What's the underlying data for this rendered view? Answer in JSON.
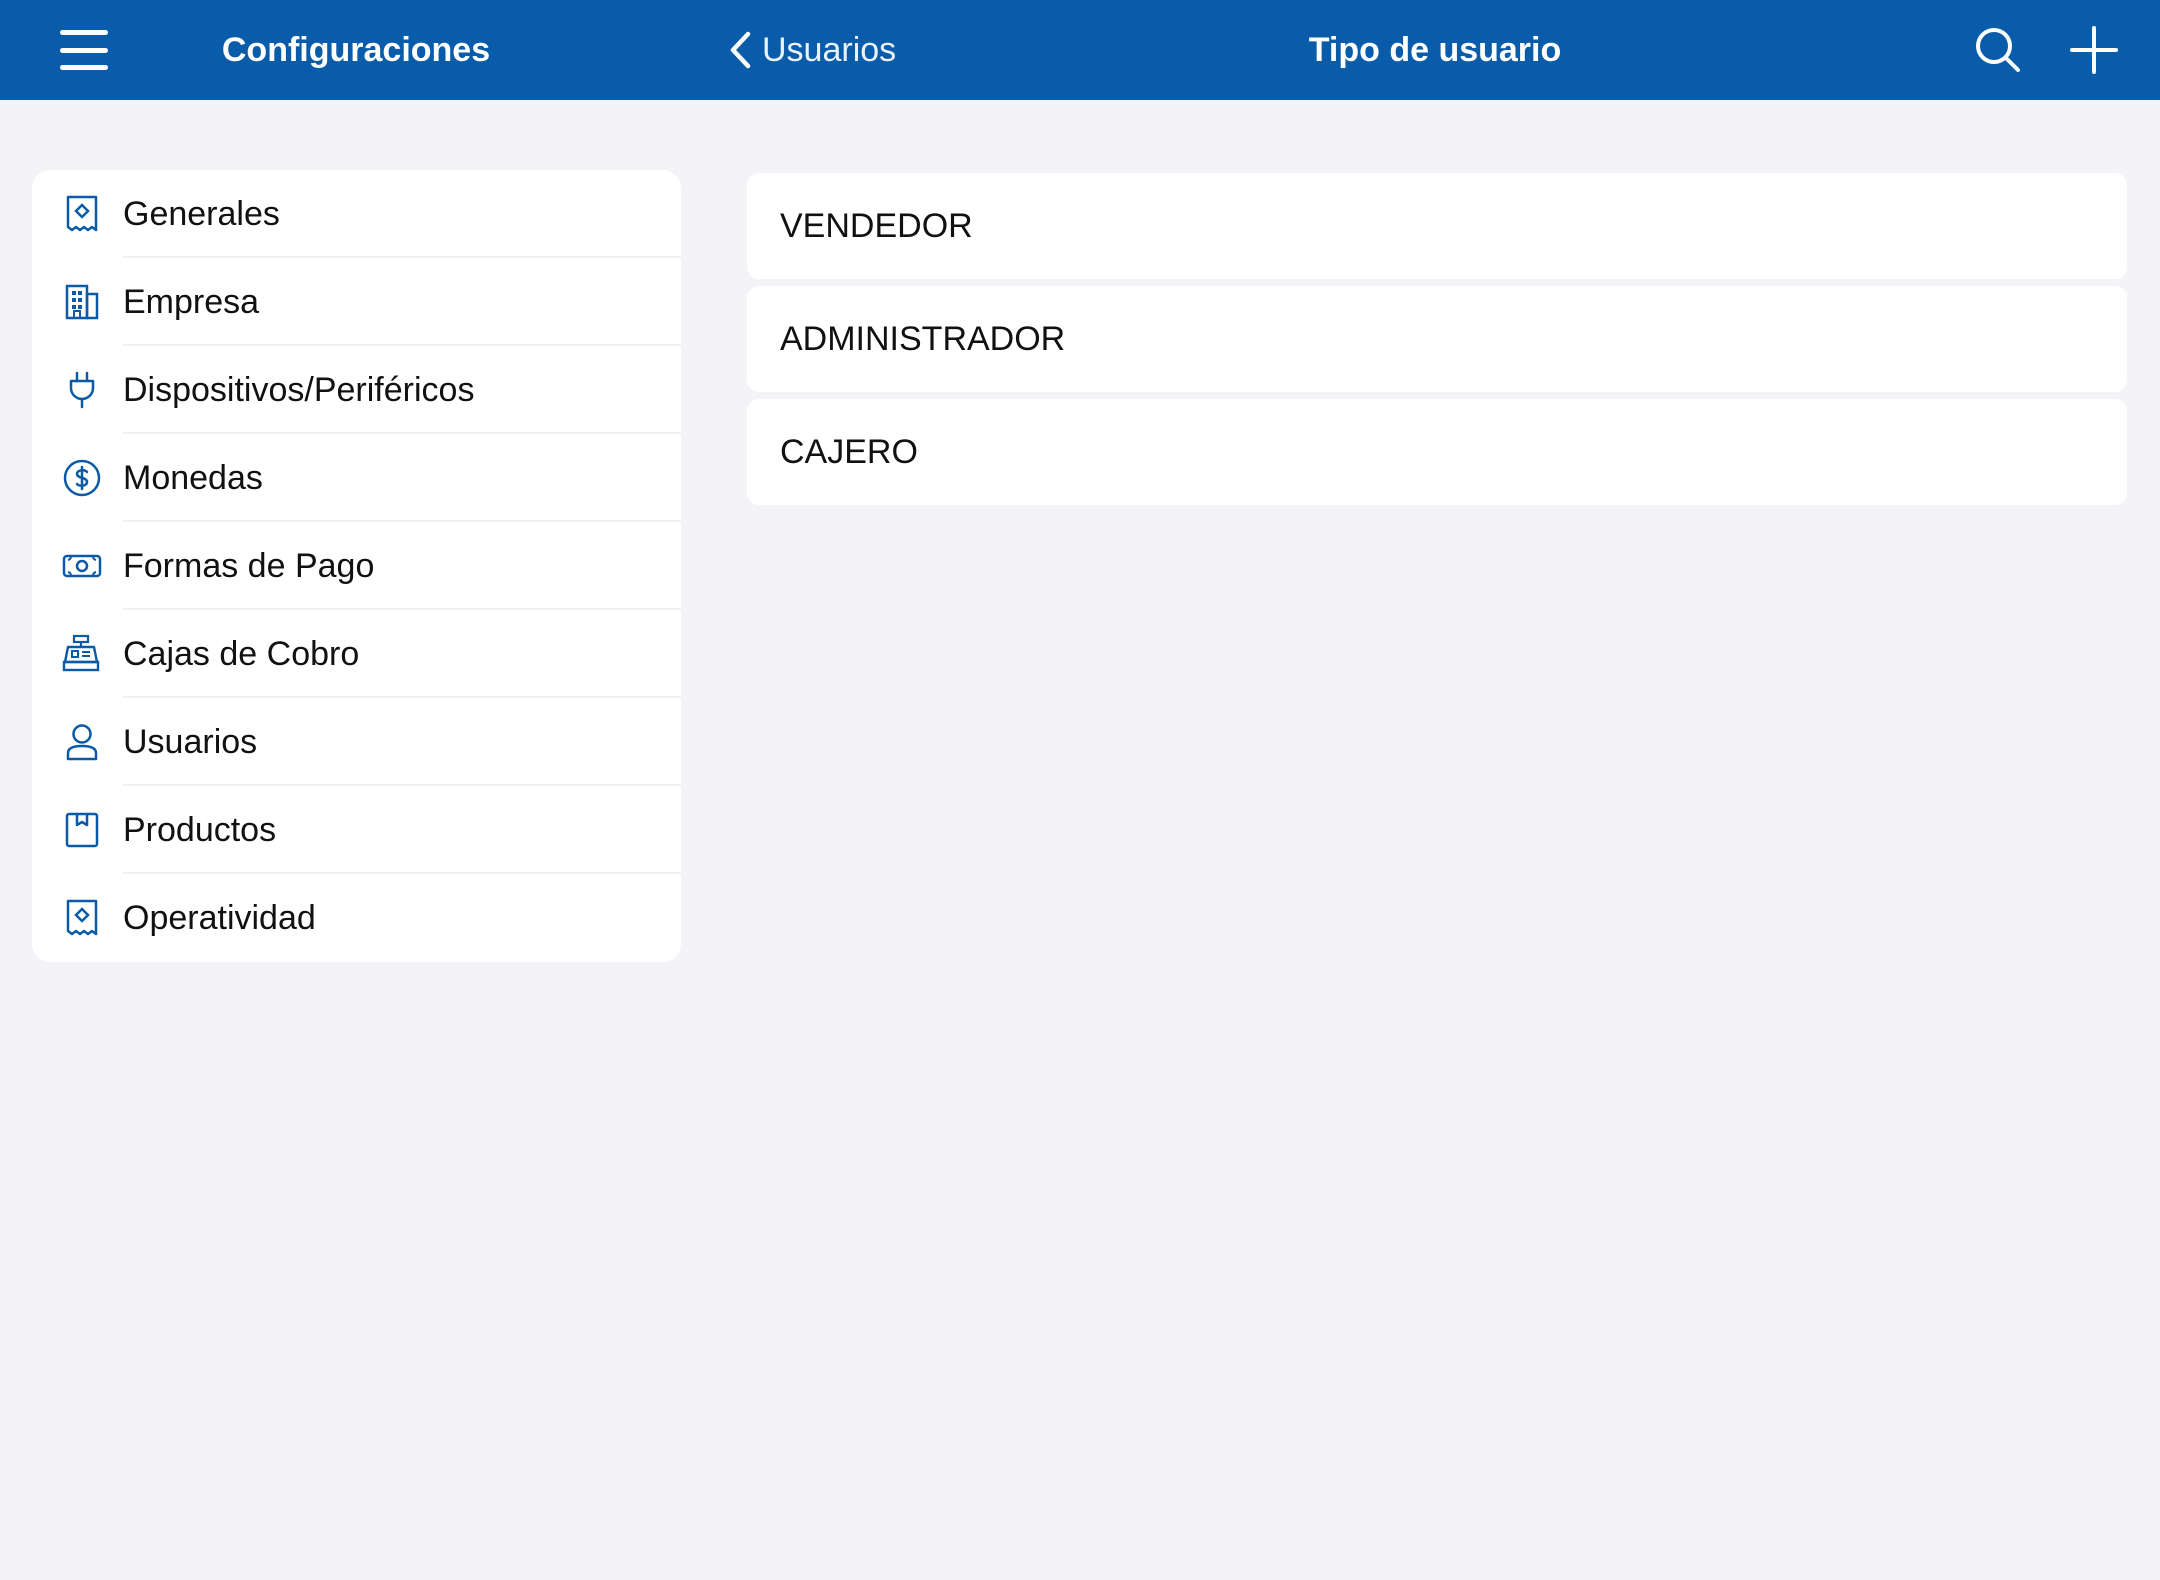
{
  "header": {
    "menu_icon": "hamburger-menu-icon",
    "sidebar_title": "Configuraciones",
    "back_label": "Usuarios",
    "title": "Tipo de usuario",
    "search_icon": "search-icon",
    "add_icon": "plus-icon",
    "bar_color": "#095ca9"
  },
  "sidebar": {
    "items": [
      {
        "label": "Generales",
        "icon": "receipt-icon"
      },
      {
        "label": "Empresa",
        "icon": "building-icon"
      },
      {
        "label": "Dispositivos/Periféricos",
        "icon": "plug-icon"
      },
      {
        "label": "Monedas",
        "icon": "dollar-circle-icon"
      },
      {
        "label": "Formas de Pago",
        "icon": "banknote-icon"
      },
      {
        "label": "Cajas de Cobro",
        "icon": "cash-register-icon"
      },
      {
        "label": "Usuarios",
        "icon": "user-icon"
      },
      {
        "label": "Productos",
        "icon": "box-icon"
      },
      {
        "label": "Operatividad",
        "icon": "receipt-icon"
      }
    ],
    "icon_color": "#0a5aa8"
  },
  "main": {
    "user_types": [
      "VENDEDOR",
      "ADMINISTRADOR",
      "CAJERO"
    ]
  }
}
